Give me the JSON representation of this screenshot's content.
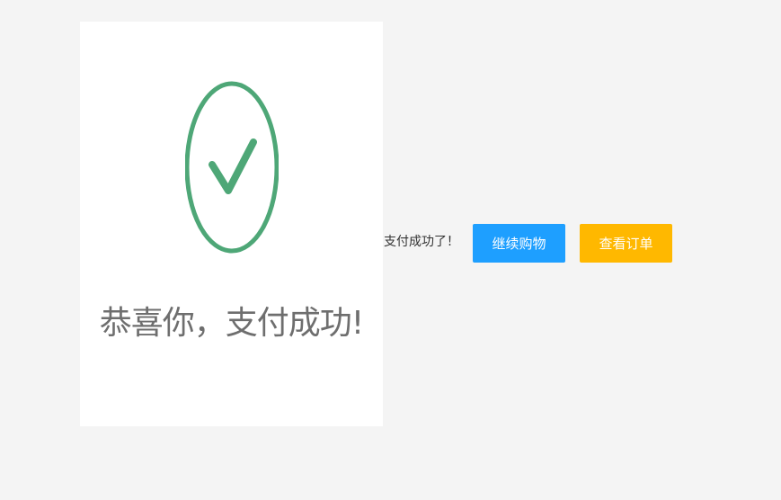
{
  "success_image": {
    "icon": "check-circle-icon",
    "icon_color": "#4ea777",
    "caption": "恭喜你，支付成功!"
  },
  "status": {
    "message": "支付成功了！"
  },
  "actions": {
    "continue_label": "继续购物",
    "continue_color": "#1e9fff",
    "orders_label": "查看订单",
    "orders_color": "#ffb800"
  }
}
